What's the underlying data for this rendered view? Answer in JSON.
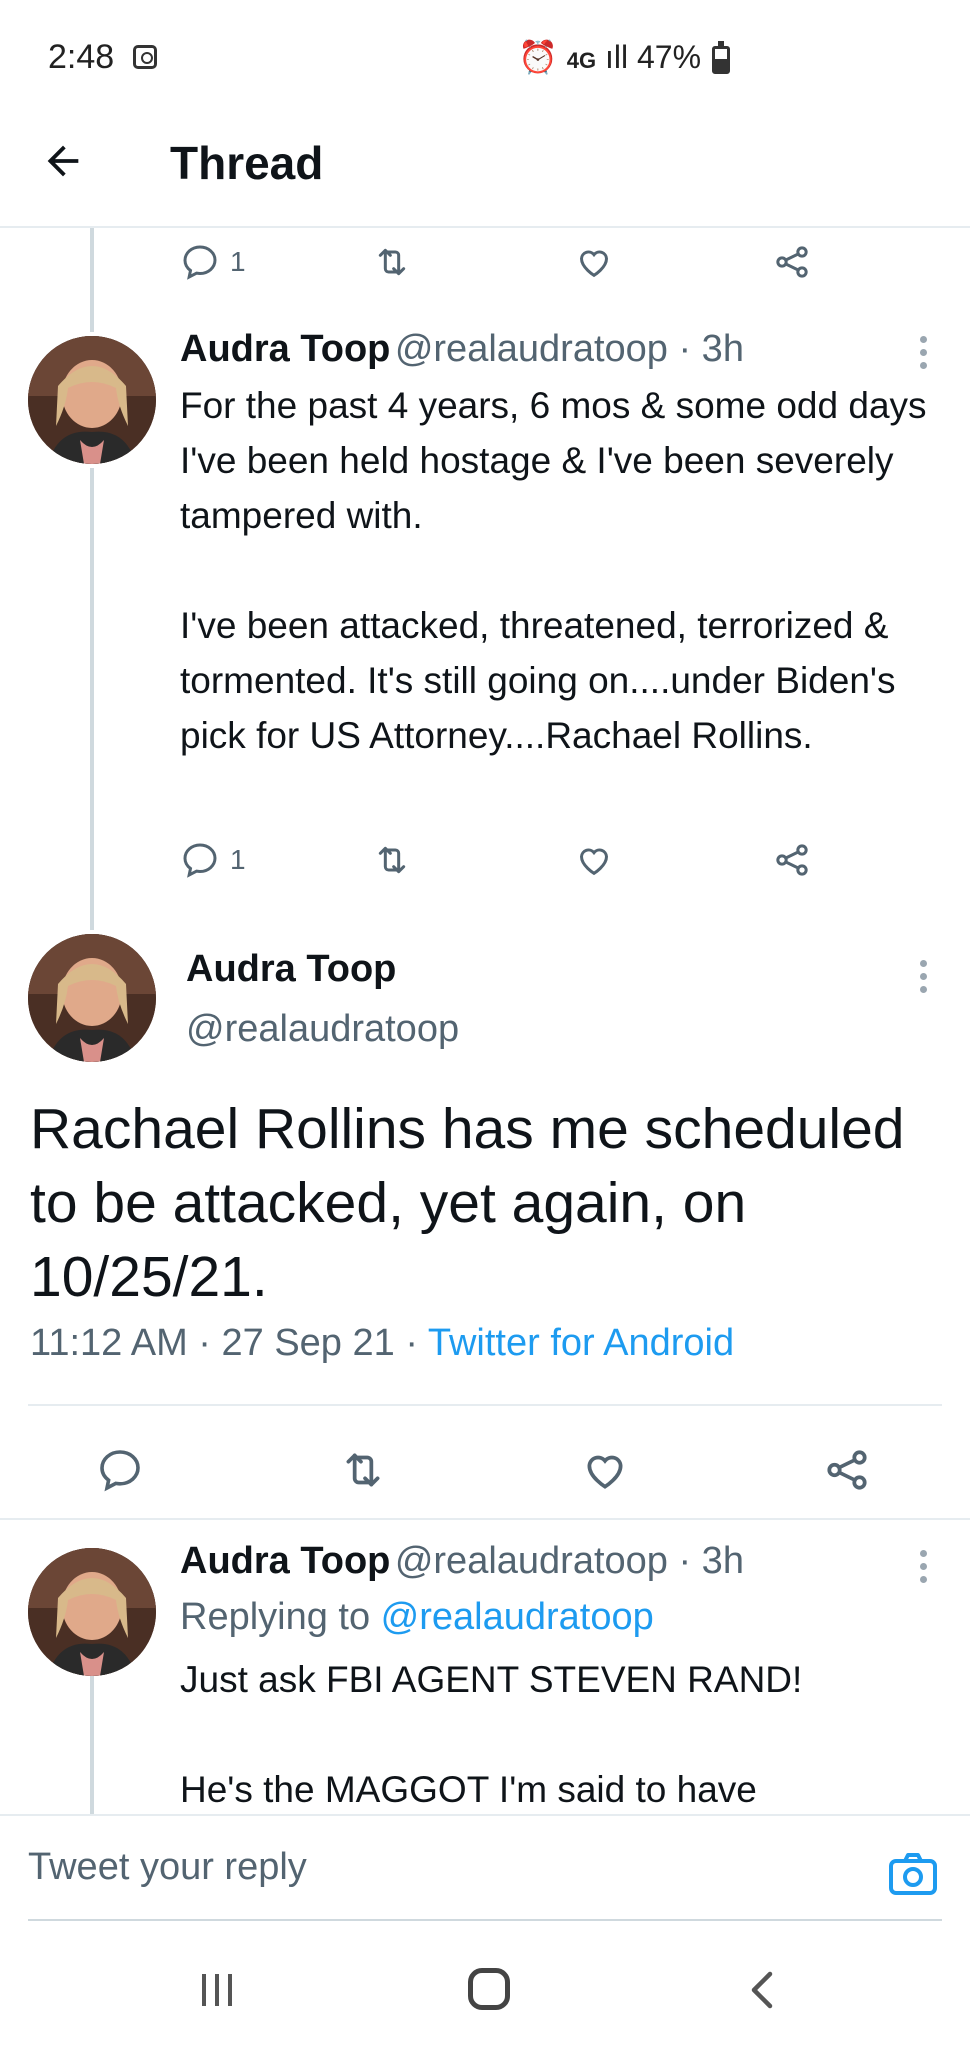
{
  "status_bar": {
    "time": "2:48",
    "right_text": "⏰ 4G ıll 47%",
    "battery": "47%"
  },
  "header": {
    "title": "Thread"
  },
  "top_action_bar": {
    "reply_count": "1"
  },
  "tweets": [
    {
      "name": "Audra Toop",
      "meta": "@realaudratoop · 3h",
      "text": "For the past 4 years, 6 mos & some odd days I've been held hostage & I've been severely tampered with.\n\nI've been attacked, threatened, terrorized & tormented. It's still going on....under Biden's pick for US Attorney....Rachael Rollins.",
      "reply_count": "1"
    }
  ],
  "focus_tweet": {
    "name": "Audra Toop",
    "handle": "@realaudratoop",
    "text": "Rachael Rollins has me scheduled to be attacked, yet again, on 10/25/21.",
    "time_date": "11:12 AM · 27 Sep 21 · ",
    "source": "Twitter for Android"
  },
  "reply_tweet": {
    "name": "Audra Toop",
    "meta": "@realaudratoop · 3h",
    "replying_prefix": "Replying to ",
    "replying_handle": "@realaudratoop",
    "text": "Just ask FBI AGENT STEVEN RAND!\n\nHe's the MAGGOT I'm said to have"
  },
  "composer": {
    "placeholder": "Tweet your reply"
  },
  "colors": {
    "accent": "#1d9bf0",
    "text": "#0f1419",
    "muted": "#536471",
    "divider": "#e6ecf0"
  }
}
